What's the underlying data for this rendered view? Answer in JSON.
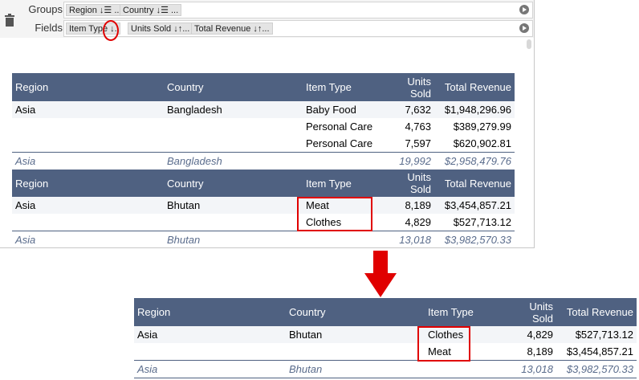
{
  "pivot": {
    "groups_label": "Groups",
    "fields_label": "Fields",
    "group_chips": [
      "Region ↓☰ ...",
      "Country ↓☰ ..."
    ],
    "field_chips": [
      "Item Type ↓.",
      "Units Sold ↓↑...",
      "Total Revenue ↓↑..."
    ]
  },
  "table_headers": [
    "Region",
    "Country",
    "Item Type",
    "Units Sold",
    "Total Revenue"
  ],
  "before": {
    "bangladesh": {
      "rows": [
        [
          "Asia",
          "Bangladesh",
          "Baby Food",
          "7,632",
          "$1,948,296.96"
        ],
        [
          "",
          "",
          "Personal Care",
          "4,763",
          "$389,279.99"
        ],
        [
          "",
          "",
          "Personal Care",
          "7,597",
          "$620,902.81"
        ]
      ],
      "total": [
        "Asia",
        "Bangladesh",
        "",
        "19,992",
        "$2,958,479.76"
      ]
    },
    "bhutan": {
      "rows": [
        [
          "Asia",
          "Bhutan",
          "Meat",
          "8,189",
          "$3,454,857.21"
        ],
        [
          "",
          "",
          "Clothes",
          "4,829",
          "$527,713.12"
        ]
      ],
      "total": [
        "Asia",
        "Bhutan",
        "",
        "13,018",
        "$3,982,570.33"
      ]
    }
  },
  "after": {
    "rows": [
      [
        "Asia",
        "Bhutan",
        "Clothes",
        "4,829",
        "$527,713.12"
      ],
      [
        "",
        "",
        "Meat",
        "8,189",
        "$3,454,857.21"
      ]
    ],
    "total": [
      "Asia",
      "Bhutan",
      "",
      "13,018",
      "$3,982,570.33"
    ]
  },
  "colors": {
    "header_bg": "#4f6181",
    "highlight": "#e00000",
    "arrow": "#e00000"
  }
}
